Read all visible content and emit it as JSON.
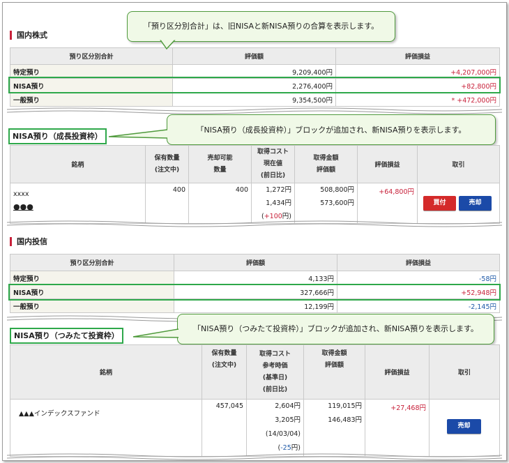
{
  "callouts": {
    "top": "「預り区分別合計」は、旧NISAと新NISA預りの合算を表示します。",
    "growth": "「NISA預り（成長投資枠）」ブロックが追加され、新NISA預りを表示します。",
    "tsumitate": "「NISA預り（つみたて投資枠）」ブロックが追加され、新NISA預りを表示します。"
  },
  "domestic_stock": {
    "title": "国内株式",
    "headers": [
      "預り区分別合計",
      "評価額",
      "評価損益"
    ],
    "rows": [
      {
        "label": "特定預り",
        "value": "9,209,400円",
        "pl": "+4,207,000円"
      },
      {
        "label": "NISA預り",
        "value": "2,276,400円",
        "pl": "+82,800円"
      },
      {
        "label": "一般預り",
        "value": "9,354,500円",
        "pl": "* +472,000円"
      }
    ]
  },
  "nisa_growth": {
    "title": "NISA預り（成長投資枠）",
    "headers": {
      "name": "銘柄",
      "qty1": "保有数量",
      "qty2": "(注文中)",
      "sell1": "売却可能",
      "sell2": "数量",
      "cost1": "取得コスト",
      "cost2": "現在値",
      "cost3": "(前日比)",
      "amt1": "取得金額",
      "amt2": "評価額",
      "pl": "評価損益",
      "trade": "取引"
    },
    "row": {
      "name1": "xxxx",
      "name2": "●●●",
      "qty": "400",
      "sellable": "400",
      "cost": "1,272円",
      "price": "1,434円",
      "change_prefix": "(",
      "change": "+100",
      "change_suffix": "円)",
      "acq_amount": "508,800円",
      "eval_amount": "573,600円",
      "pl": "+64,800円",
      "buy_label": "買付",
      "sell_label": "売却"
    }
  },
  "domestic_fund": {
    "title": "国内投信",
    "headers": [
      "預り区分別合計",
      "評価額",
      "評価損益"
    ],
    "rows": [
      {
        "label": "特定預り",
        "value": "4,133円",
        "pl": "-58円"
      },
      {
        "label": "NISA預り",
        "value": "327,666円",
        "pl": "+52,948円"
      },
      {
        "label": "一般預り",
        "value": "12,199円",
        "pl": "-2,145円"
      }
    ]
  },
  "nisa_tsumitate": {
    "title": "NISA預り（つみたて投資枠）",
    "headers": {
      "name": "銘柄",
      "qty1": "保有数量",
      "qty2": "(注文中)",
      "cost1": "取得コスト",
      "cost2": "参考時価",
      "cost3": "(基準日)",
      "cost4": "(前日比)",
      "amt1": "取得金額",
      "amt2": "評価額",
      "pl": "評価損益",
      "trade": "取引"
    },
    "row": {
      "name": "▲▲▲インデックスファンド",
      "qty": "457,045",
      "cost": "2,604円",
      "ref_price": "3,205円",
      "base_date": "(14/03/04)",
      "change_prefix": "(",
      "change": "-25",
      "change_suffix": "円)",
      "acq_amount": "119,015円",
      "eval_amount": "146,483円",
      "pl": "+27,468円",
      "sell_label": "売却"
    }
  },
  "colors": {
    "positive": "#c8213a",
    "negative": "#1f5aa8",
    "highlight": "#2ea84a",
    "section_bar": "#c8213a"
  }
}
